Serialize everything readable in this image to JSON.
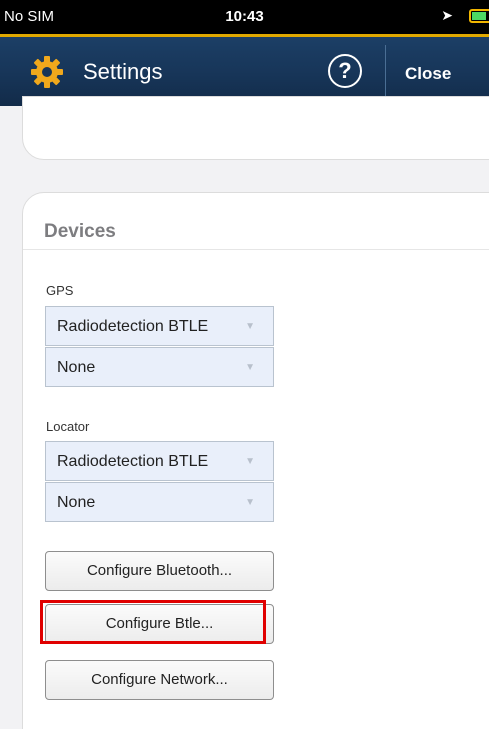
{
  "status_bar": {
    "carrier": "No SIM",
    "time": "10:43"
  },
  "nav": {
    "title": "Settings",
    "help": "?",
    "close": "Close"
  },
  "devices": {
    "title": "Devices",
    "gps_label": "GPS",
    "gps_device": "Radiodetection BTLE",
    "gps_secondary": "None",
    "locator_label": "Locator",
    "locator_device": "Radiodetection BTLE",
    "locator_secondary": "None"
  },
  "buttons": {
    "bluetooth": "Configure Bluetooth...",
    "btle": "Configure Btle...",
    "network": "Configure Network..."
  },
  "colors": {
    "nav_bg": "#173558",
    "nav_border": "#e0a800",
    "highlight": "#e00000",
    "select_bg": "#e9effa"
  }
}
